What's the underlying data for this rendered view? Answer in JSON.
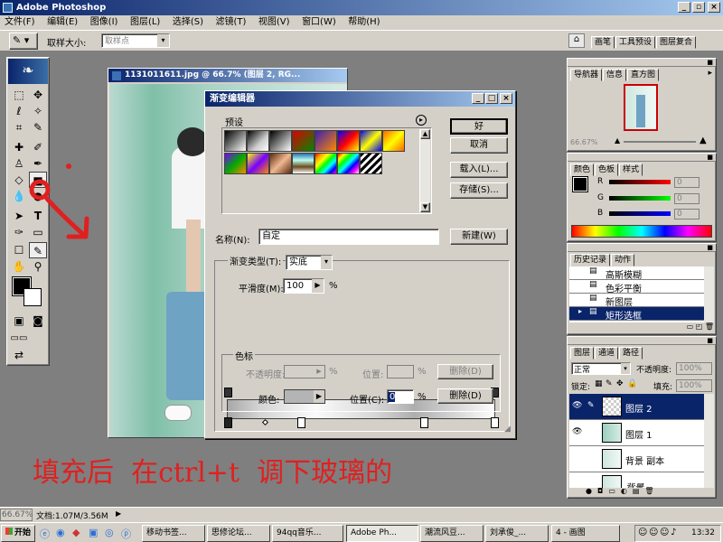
{
  "app": {
    "title": "Adobe Photoshop"
  },
  "menu": [
    "文件(F)",
    "编辑(E)",
    "图像(I)",
    "图层(L)",
    "选择(S)",
    "滤镜(T)",
    "视图(V)",
    "窗口(W)",
    "帮助(H)"
  ],
  "options": {
    "sample_label": "取样大小:",
    "sample_value": "取样点"
  },
  "palette_well": [
    "画笔",
    "工具预设",
    "图层复合"
  ],
  "document": {
    "title": "1131011611.jpg @ 66.7% (图层 2, RG..."
  },
  "gradient_editor": {
    "title": "渐变编辑器",
    "presets_label": "预设",
    "ok": "好",
    "cancel": "取消",
    "load": "载入(L)...",
    "save": "存储(S)...",
    "name_label": "名称(N):",
    "name_value": "自定",
    "new_button": "新建(W)",
    "type_label": "渐变类型(T):",
    "type_value": "实底",
    "smooth_label": "平滑度(M):",
    "smooth_value": "100",
    "percent": "%",
    "stops_group": "色标",
    "opacity_label": "不透明度:",
    "location_label_disabled": "位置:",
    "delete_disabled": "删除(D)",
    "color_label": "颜色:",
    "location_label": "位置(C):",
    "location_value": "0",
    "delete": "删除(D)"
  },
  "navigator": {
    "tabs": [
      "导航器",
      "信息",
      "直方图"
    ],
    "zoom": "66.67%"
  },
  "color": {
    "tabs": [
      "颜色",
      "色板",
      "样式"
    ],
    "r": "R",
    "g": "G",
    "b": "B",
    "r_val": "0",
    "g_val": "0",
    "b_val": "0"
  },
  "history": {
    "tabs": [
      "历史记录",
      "动作"
    ],
    "items": [
      "高斯模糊",
      "色彩平衡",
      "新图层",
      "矩形选框"
    ]
  },
  "layers": {
    "tabs": [
      "图层",
      "通道",
      "路径"
    ],
    "mode": "正常",
    "opacity_label": "不透明度:",
    "opacity_value": "100%",
    "lock_label": "锁定:",
    "fill_label": "填充:",
    "fill_value": "100%",
    "items": [
      "图层 2",
      "图层 1",
      "背景 副本",
      "背景"
    ]
  },
  "status": {
    "zoom": "66.67%",
    "doc": "文档:1.07M/3.56M"
  },
  "annotation": {
    "text": "填充后  在ctrl+t  调下玻璃的"
  },
  "taskbar": {
    "start": "开始",
    "items": [
      "移动书签...",
      "思修论坛...",
      "94qq音乐...",
      "Adobe Ph...",
      "潮流风豆...",
      "刘承俊_...",
      "4 - 画图"
    ],
    "clock": "13:32"
  },
  "colors": {
    "title_active": "#0a246a",
    "face": "#d4d0c8",
    "workspace": "#7f7f7f",
    "annotation": "#e02020",
    "selection": "#0a246a"
  }
}
